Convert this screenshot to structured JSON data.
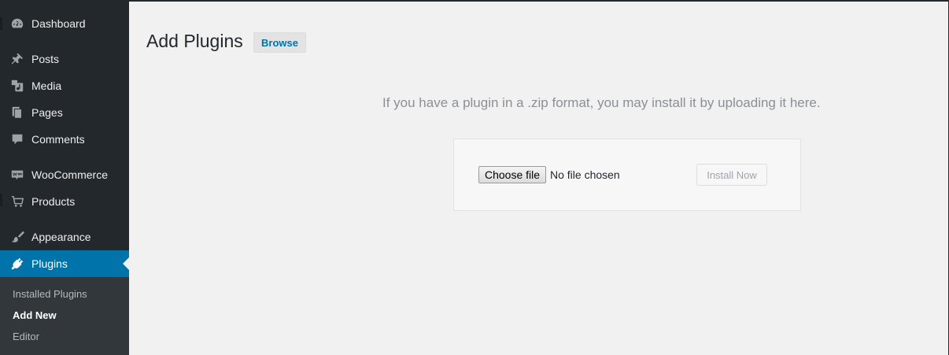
{
  "sidebar": {
    "items": [
      {
        "label": "Dashboard",
        "icon": "dashboard-icon"
      },
      {
        "label": "Posts",
        "icon": "pushpin-icon"
      },
      {
        "label": "Media",
        "icon": "media-icon"
      },
      {
        "label": "Pages",
        "icon": "pages-icon"
      },
      {
        "label": "Comments",
        "icon": "comment-bubble-icon"
      },
      {
        "label": "WooCommerce",
        "icon": "woocommerce-icon"
      },
      {
        "label": "Products",
        "icon": "cart-icon"
      },
      {
        "label": "Appearance",
        "icon": "paintbrush-icon"
      },
      {
        "label": "Plugins",
        "icon": "plugin-icon",
        "current": true
      }
    ],
    "submenu": [
      {
        "label": "Installed Plugins"
      },
      {
        "label": "Add New",
        "current": true
      },
      {
        "label": "Editor"
      }
    ]
  },
  "main": {
    "title": "Add Plugins",
    "browse_label": "Browse",
    "upload_help": "If you have a plugin in a .zip format, you may install it by uploading it here.",
    "choose_file_label": "Choose file",
    "no_file_text": "No file chosen",
    "install_label": "Install Now"
  },
  "colors": {
    "sidebar_bg": "#23282d",
    "submenu_bg": "#32373c",
    "accent": "#0073aa",
    "page_bg": "#f1f1f1"
  }
}
